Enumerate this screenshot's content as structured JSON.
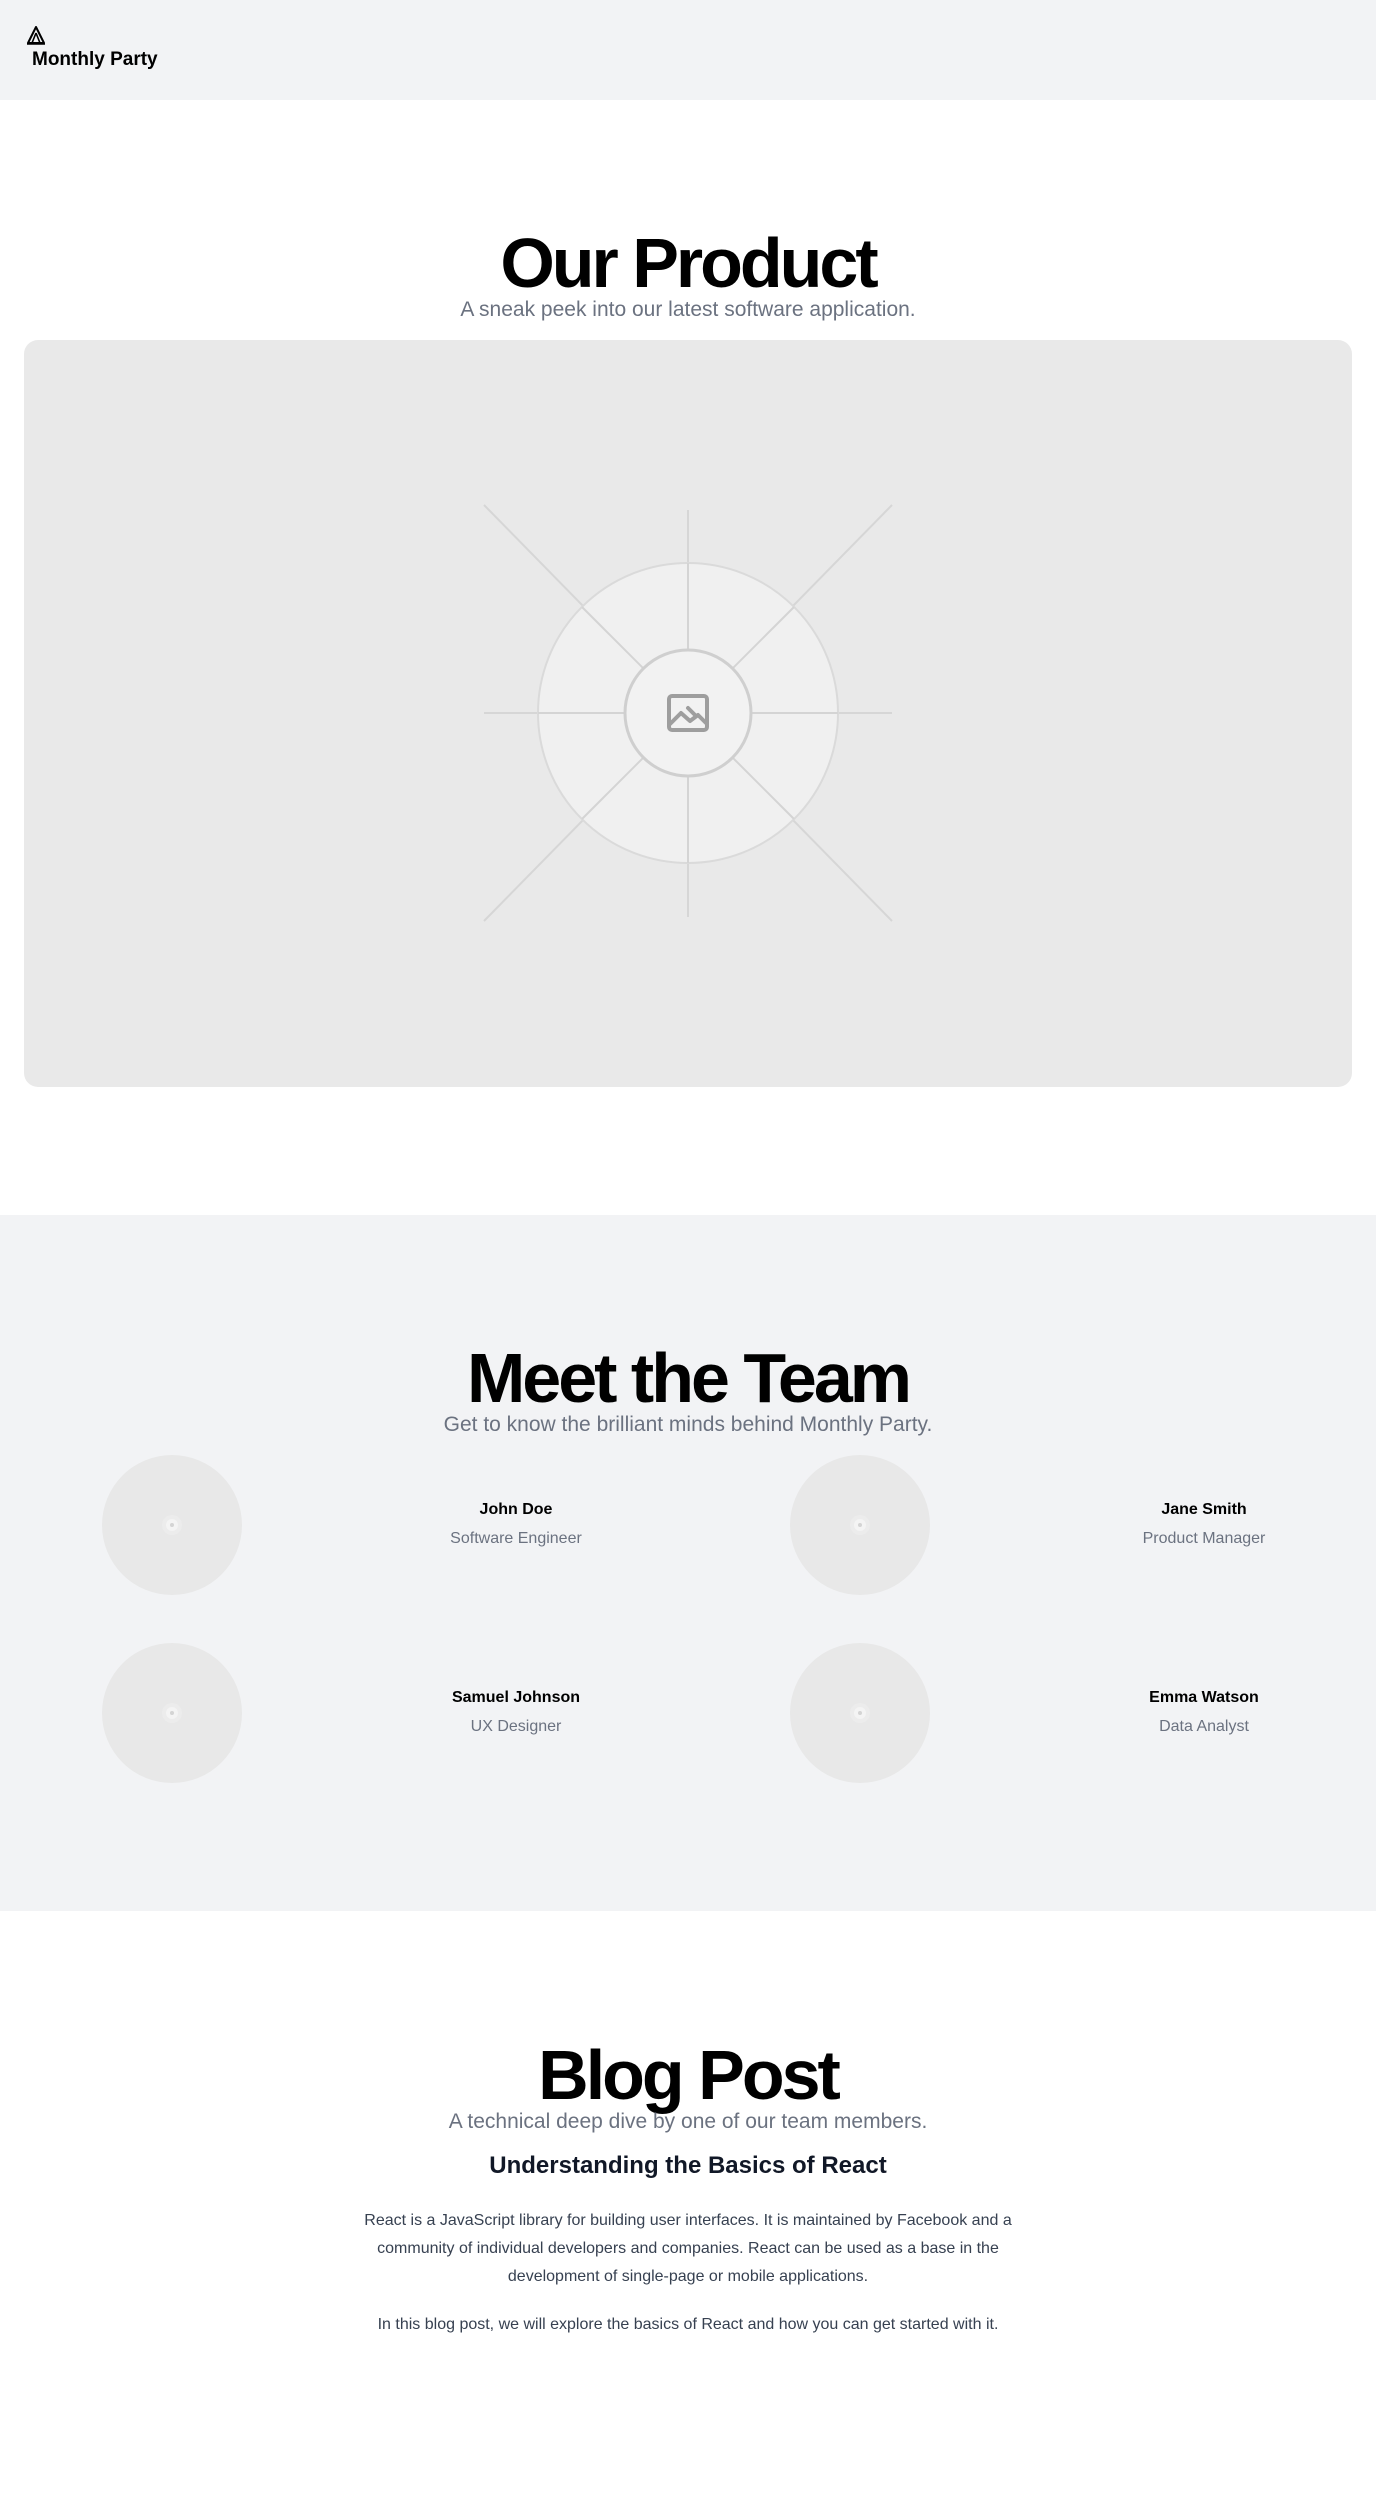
{
  "header": {
    "brand": "Monthly Party",
    "logo_icon": "tent-icon"
  },
  "product": {
    "title": "Our Product",
    "subtitle": "A sneak peek into our latest software application.",
    "image_icon": "image-placeholder-icon"
  },
  "team": {
    "title": "Meet the Team",
    "subtitle": "Get to know the brilliant minds behind Monthly Party.",
    "members": [
      {
        "name": "John Doe",
        "role": "Software Engineer"
      },
      {
        "name": "Jane Smith",
        "role": "Product Manager"
      },
      {
        "name": "Samuel Johnson",
        "role": "UX Designer"
      },
      {
        "name": "Emma Watson",
        "role": "Data Analyst"
      }
    ]
  },
  "blog": {
    "title": "Blog Post",
    "subtitle": "A technical deep dive by one of our team members.",
    "post_title": "Understanding the Basics of React",
    "paragraphs": [
      "React is a JavaScript library for building user interfaces. It is maintained by Facebook and a community of individual developers and companies. React can be used as a base in the development of single-page or mobile applications.",
      "In this blog post, we will explore the basics of React and how you can get started with it."
    ]
  },
  "colors": {
    "header_bg": "#f2f3f5",
    "muted_text": "#6b7280",
    "placeholder_bg": "#e9e9e9"
  }
}
